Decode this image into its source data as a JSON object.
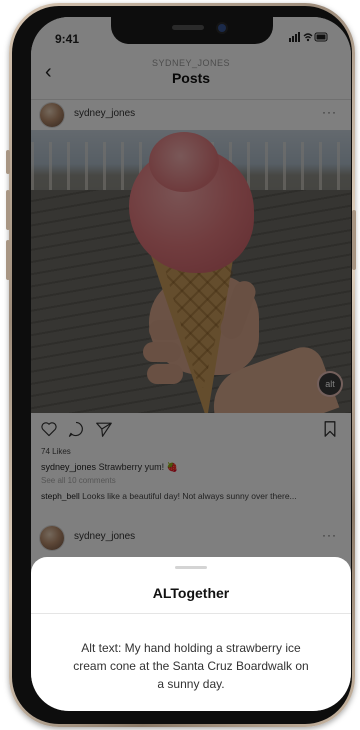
{
  "status": {
    "time": "9:41",
    "icons": "all ᯤ ▬"
  },
  "nav": {
    "back_icon": "‹",
    "subtitle": "SYDNEY_JONES",
    "title": "Posts"
  },
  "post": {
    "username": "sydney_jones",
    "more_icon": "···",
    "alt_badge": "alt",
    "likes": "74 Likes",
    "caption_user": "sydney_jones",
    "caption_text": "Strawberry yum! 🍓",
    "view_all": "See all 10 comments",
    "comment_user": "steph_bell",
    "comment_text": "Looks like a beautiful day!  Not always sunny over there..."
  },
  "post2": {
    "username": "sydney_jones",
    "more_icon": "···"
  },
  "sheet": {
    "title": "ALTogether",
    "alt_text": "Alt text: My hand holding a strawberry ice cream cone at the Santa Cruz Boardwalk on a sunny day."
  }
}
